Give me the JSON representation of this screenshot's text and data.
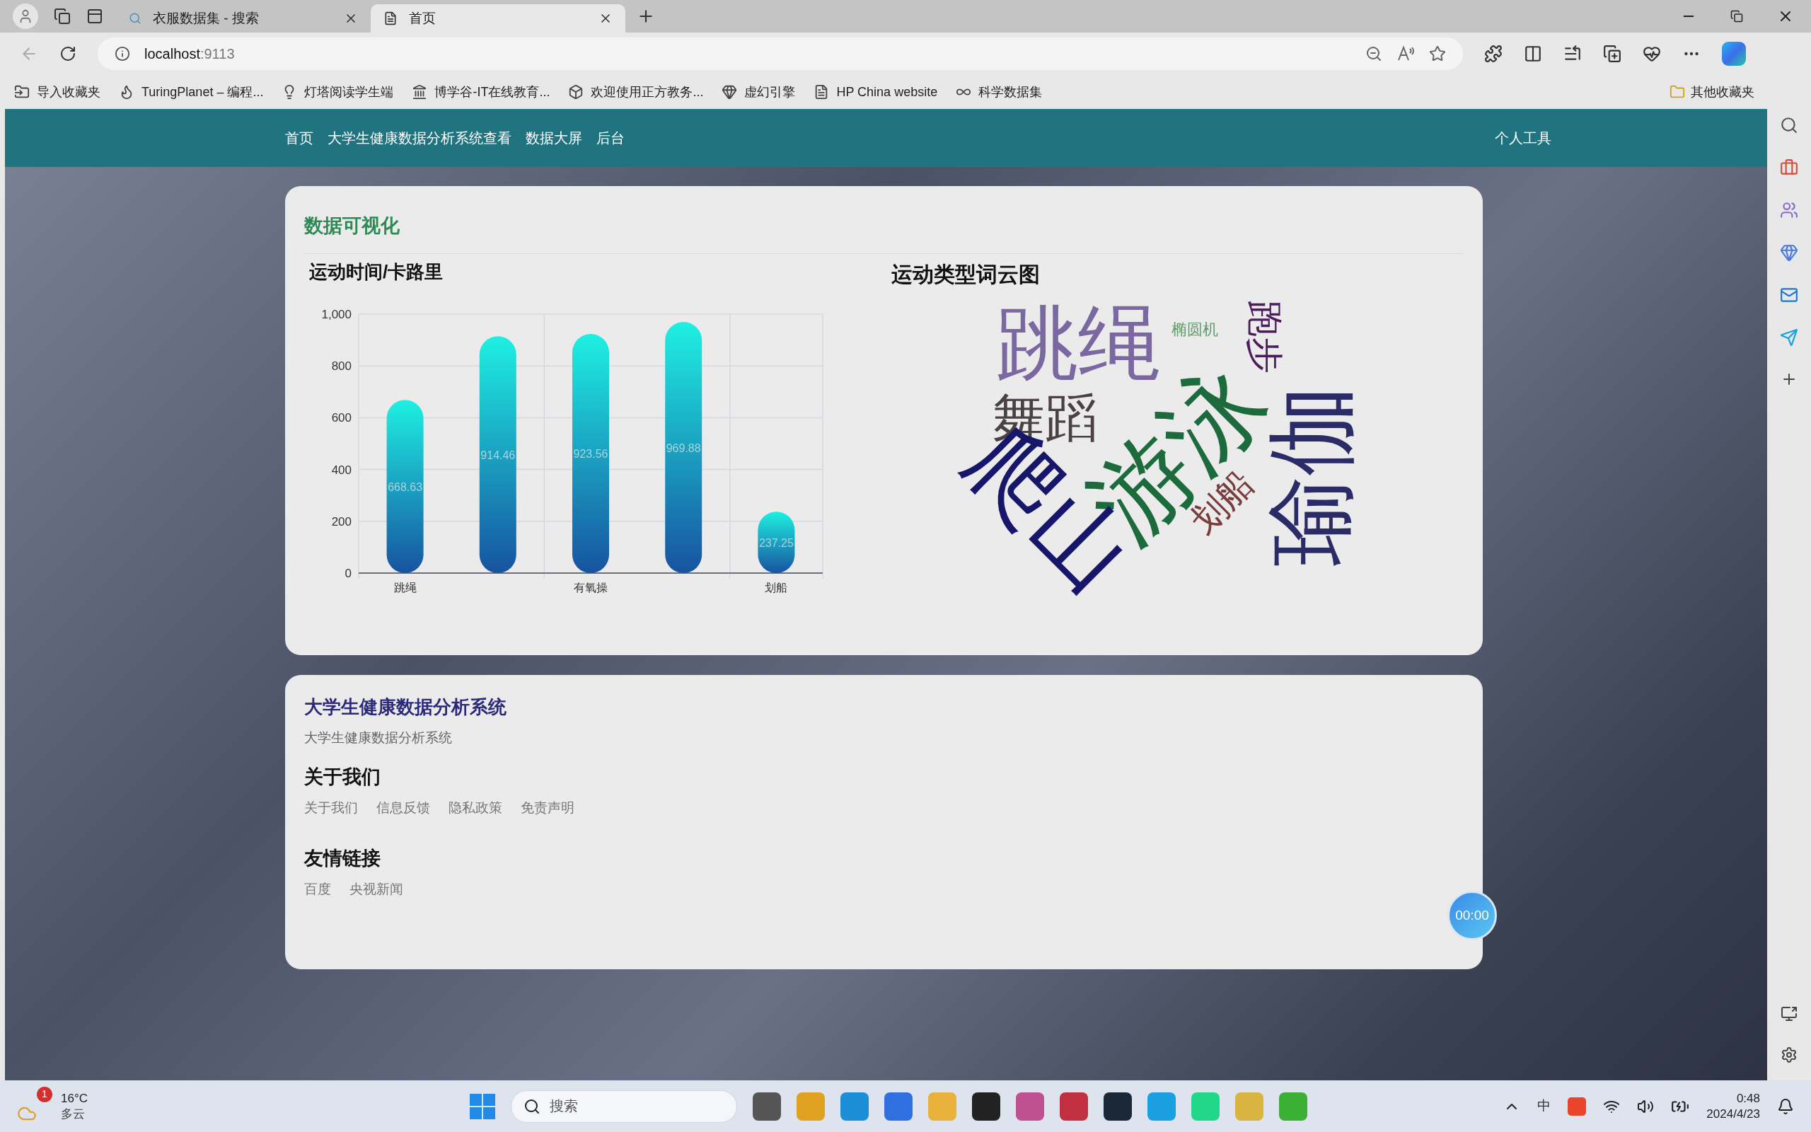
{
  "browser": {
    "tabs": [
      {
        "title": "衣服数据集 - 搜索",
        "kind": "search",
        "selected": false
      },
      {
        "title": "首页",
        "kind": "page",
        "selected": true
      }
    ],
    "address": {
      "host": "localhost",
      "port": ":9113"
    },
    "bookmarks": [
      "导入收藏夹",
      "TuringPlanet – 编程...",
      "灯塔阅读学生端",
      "博学谷-IT在线教育...",
      "欢迎使用正方教务...",
      "虚幻引擎",
      "HP China website",
      "科学数据集"
    ],
    "other_bookmarks": "其他收藏夹"
  },
  "navbar": {
    "items": [
      "首页",
      "大学生健康数据分析系统查看",
      "数据大屏",
      "后台"
    ],
    "right": "个人工具"
  },
  "viz_card": {
    "title": "数据可视化",
    "bar_chart": {
      "chart_data": {
        "type": "bar",
        "title": "运动时间/卡路里",
        "categories": [
          "跳绳",
          null,
          "有氧操",
          null,
          "划船"
        ],
        "values": [
          668.63,
          914.46,
          923.56,
          969.88,
          237.25
        ],
        "ylim": [
          0,
          1000
        ],
        "yticks": [
          0,
          {
            "value": 200,
            "label": "200"
          },
          {
            "value": 400,
            "label": "400"
          },
          {
            "value": 600,
            "label": "600"
          },
          {
            "value": 800,
            "label": "800"
          },
          {
            "value": 1000,
            "label": "1,000"
          }
        ],
        "data_labels": true,
        "grid": true
      }
    },
    "word_cloud": {
      "title": "运动类型词云图",
      "words": [
        {
          "text": "跳绳",
          "color": "#7b68a0"
        },
        {
          "text": "椭圆机",
          "color": "#5f9b6b"
        },
        {
          "text": "跑步",
          "color": "#4b1d5c"
        },
        {
          "text": "舞蹈",
          "color": "#4a4242"
        },
        {
          "text": "游泳",
          "color": "#1d6a3d"
        },
        {
          "text": "瑜伽",
          "color": "#2b2b68"
        },
        {
          "text": "爬山",
          "color": "#16166a"
        },
        {
          "text": "划船",
          "color": "#7a3c3c"
        }
      ]
    }
  },
  "footer_card": {
    "title": "大学生健康数据分析系统",
    "subtitle": "大学生健康数据分析系统",
    "sections": [
      {
        "heading": "关于我们",
        "links": [
          "关于我们",
          "信息反馈",
          "隐私政策",
          "免责声明"
        ]
      },
      {
        "heading": "友情链接",
        "links": [
          "百度",
          "央视新闻"
        ]
      }
    ],
    "timer": "00:00"
  },
  "taskbar": {
    "weather": {
      "badge": "1",
      "temp": "16°C",
      "desc": "多云"
    },
    "search": {
      "placeholder": "搜索"
    },
    "ime": "中",
    "time": "0:48",
    "date": "2024/4/23"
  }
}
